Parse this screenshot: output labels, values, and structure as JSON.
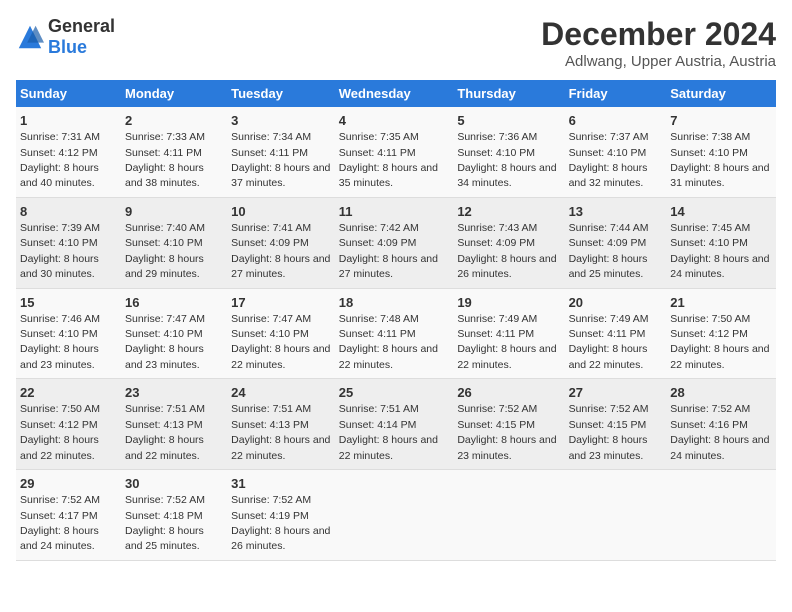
{
  "logo": {
    "text_general": "General",
    "text_blue": "Blue"
  },
  "title": "December 2024",
  "subtitle": "Adlwang, Upper Austria, Austria",
  "days_of_week": [
    "Sunday",
    "Monday",
    "Tuesday",
    "Wednesday",
    "Thursday",
    "Friday",
    "Saturday"
  ],
  "weeks": [
    [
      {
        "day": "1",
        "sunrise": "7:31 AM",
        "sunset": "4:12 PM",
        "daylight": "8 hours and 40 minutes."
      },
      {
        "day": "2",
        "sunrise": "7:33 AM",
        "sunset": "4:11 PM",
        "daylight": "8 hours and 38 minutes."
      },
      {
        "day": "3",
        "sunrise": "7:34 AM",
        "sunset": "4:11 PM",
        "daylight": "8 hours and 37 minutes."
      },
      {
        "day": "4",
        "sunrise": "7:35 AM",
        "sunset": "4:11 PM",
        "daylight": "8 hours and 35 minutes."
      },
      {
        "day": "5",
        "sunrise": "7:36 AM",
        "sunset": "4:10 PM",
        "daylight": "8 hours and 34 minutes."
      },
      {
        "day": "6",
        "sunrise": "7:37 AM",
        "sunset": "4:10 PM",
        "daylight": "8 hours and 32 minutes."
      },
      {
        "day": "7",
        "sunrise": "7:38 AM",
        "sunset": "4:10 PM",
        "daylight": "8 hours and 31 minutes."
      }
    ],
    [
      {
        "day": "8",
        "sunrise": "7:39 AM",
        "sunset": "4:10 PM",
        "daylight": "8 hours and 30 minutes."
      },
      {
        "day": "9",
        "sunrise": "7:40 AM",
        "sunset": "4:10 PM",
        "daylight": "8 hours and 29 minutes."
      },
      {
        "day": "10",
        "sunrise": "7:41 AM",
        "sunset": "4:09 PM",
        "daylight": "8 hours and 27 minutes."
      },
      {
        "day": "11",
        "sunrise": "7:42 AM",
        "sunset": "4:09 PM",
        "daylight": "8 hours and 27 minutes."
      },
      {
        "day": "12",
        "sunrise": "7:43 AM",
        "sunset": "4:09 PM",
        "daylight": "8 hours and 26 minutes."
      },
      {
        "day": "13",
        "sunrise": "7:44 AM",
        "sunset": "4:09 PM",
        "daylight": "8 hours and 25 minutes."
      },
      {
        "day": "14",
        "sunrise": "7:45 AM",
        "sunset": "4:10 PM",
        "daylight": "8 hours and 24 minutes."
      }
    ],
    [
      {
        "day": "15",
        "sunrise": "7:46 AM",
        "sunset": "4:10 PM",
        "daylight": "8 hours and 23 minutes."
      },
      {
        "day": "16",
        "sunrise": "7:47 AM",
        "sunset": "4:10 PM",
        "daylight": "8 hours and 23 minutes."
      },
      {
        "day": "17",
        "sunrise": "7:47 AM",
        "sunset": "4:10 PM",
        "daylight": "8 hours and 22 minutes."
      },
      {
        "day": "18",
        "sunrise": "7:48 AM",
        "sunset": "4:11 PM",
        "daylight": "8 hours and 22 minutes."
      },
      {
        "day": "19",
        "sunrise": "7:49 AM",
        "sunset": "4:11 PM",
        "daylight": "8 hours and 22 minutes."
      },
      {
        "day": "20",
        "sunrise": "7:49 AM",
        "sunset": "4:11 PM",
        "daylight": "8 hours and 22 minutes."
      },
      {
        "day": "21",
        "sunrise": "7:50 AM",
        "sunset": "4:12 PM",
        "daylight": "8 hours and 22 minutes."
      }
    ],
    [
      {
        "day": "22",
        "sunrise": "7:50 AM",
        "sunset": "4:12 PM",
        "daylight": "8 hours and 22 minutes."
      },
      {
        "day": "23",
        "sunrise": "7:51 AM",
        "sunset": "4:13 PM",
        "daylight": "8 hours and 22 minutes."
      },
      {
        "day": "24",
        "sunrise": "7:51 AM",
        "sunset": "4:13 PM",
        "daylight": "8 hours and 22 minutes."
      },
      {
        "day": "25",
        "sunrise": "7:51 AM",
        "sunset": "4:14 PM",
        "daylight": "8 hours and 22 minutes."
      },
      {
        "day": "26",
        "sunrise": "7:52 AM",
        "sunset": "4:15 PM",
        "daylight": "8 hours and 23 minutes."
      },
      {
        "day": "27",
        "sunrise": "7:52 AM",
        "sunset": "4:15 PM",
        "daylight": "8 hours and 23 minutes."
      },
      {
        "day": "28",
        "sunrise": "7:52 AM",
        "sunset": "4:16 PM",
        "daylight": "8 hours and 24 minutes."
      }
    ],
    [
      {
        "day": "29",
        "sunrise": "7:52 AM",
        "sunset": "4:17 PM",
        "daylight": "8 hours and 24 minutes."
      },
      {
        "day": "30",
        "sunrise": "7:52 AM",
        "sunset": "4:18 PM",
        "daylight": "8 hours and 25 minutes."
      },
      {
        "day": "31",
        "sunrise": "7:52 AM",
        "sunset": "4:19 PM",
        "daylight": "8 hours and 26 minutes."
      },
      null,
      null,
      null,
      null
    ]
  ],
  "labels": {
    "sunrise": "Sunrise:",
    "sunset": "Sunset:",
    "daylight": "Daylight:"
  }
}
